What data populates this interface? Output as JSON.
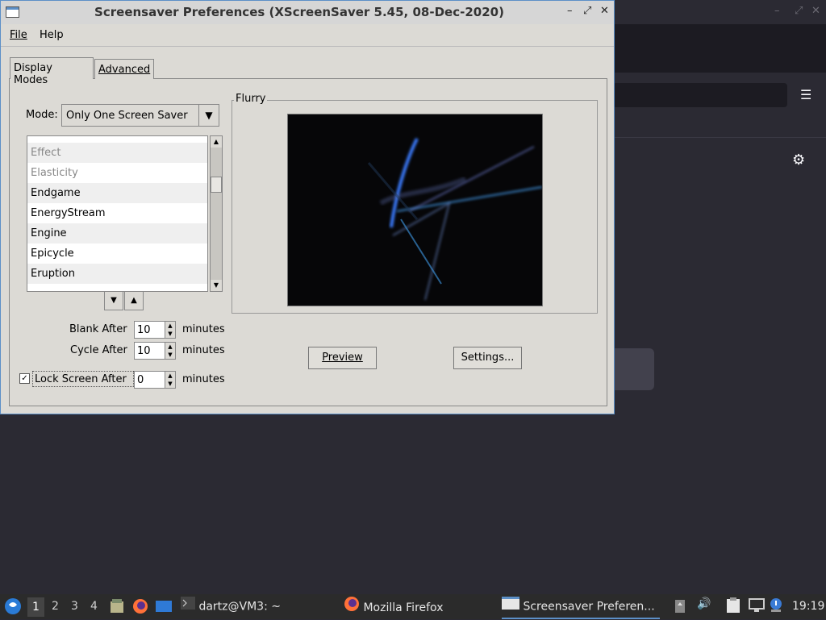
{
  "window": {
    "title": "Screensaver Preferences  (XScreenSaver 5.45, 08-Dec-2020)",
    "controls": {
      "minimize": "–",
      "maximize": "⤢",
      "close": "✕"
    }
  },
  "menubar": {
    "file": "File",
    "help": "Help"
  },
  "tabs": [
    {
      "label": "Display Modes",
      "active": true
    },
    {
      "label": "Advanced",
      "active": false
    }
  ],
  "mode": {
    "label": "Mode:",
    "value": "Only One Screen Saver"
  },
  "savers_list": {
    "items": [
      {
        "label": "Effect",
        "dim": true
      },
      {
        "label": "Elasticity",
        "dim": true
      },
      {
        "label": "Endgame",
        "dim": false
      },
      {
        "label": "EnergyStream",
        "dim": false
      },
      {
        "label": "Engine",
        "dim": false
      },
      {
        "label": "Epicycle",
        "dim": false
      },
      {
        "label": "Eruption",
        "dim": false
      }
    ]
  },
  "timers": {
    "blank_after": {
      "label": "Blank After",
      "value": "10",
      "unit": "minutes"
    },
    "cycle_after": {
      "label": "Cycle After",
      "value": "10",
      "unit": "minutes"
    },
    "lock_after": {
      "label": "Lock Screen After",
      "value": "0",
      "unit": "minutes",
      "checked": true
    }
  },
  "preview_frame": {
    "title": "Flurry"
  },
  "buttons": {
    "preview": "Preview",
    "settings": "Settings..."
  },
  "taskbar": {
    "workspaces": [
      "1",
      "2",
      "3",
      "4"
    ],
    "tasks": [
      {
        "label": "dartz@VM3: ~",
        "icon": "terminal-icon"
      },
      {
        "label": "Mozilla Firefox",
        "icon": "firefox-icon"
      },
      {
        "label": "Screensaver Preferen...",
        "icon": "window-icon",
        "active": true
      }
    ],
    "clock": "19:19"
  }
}
